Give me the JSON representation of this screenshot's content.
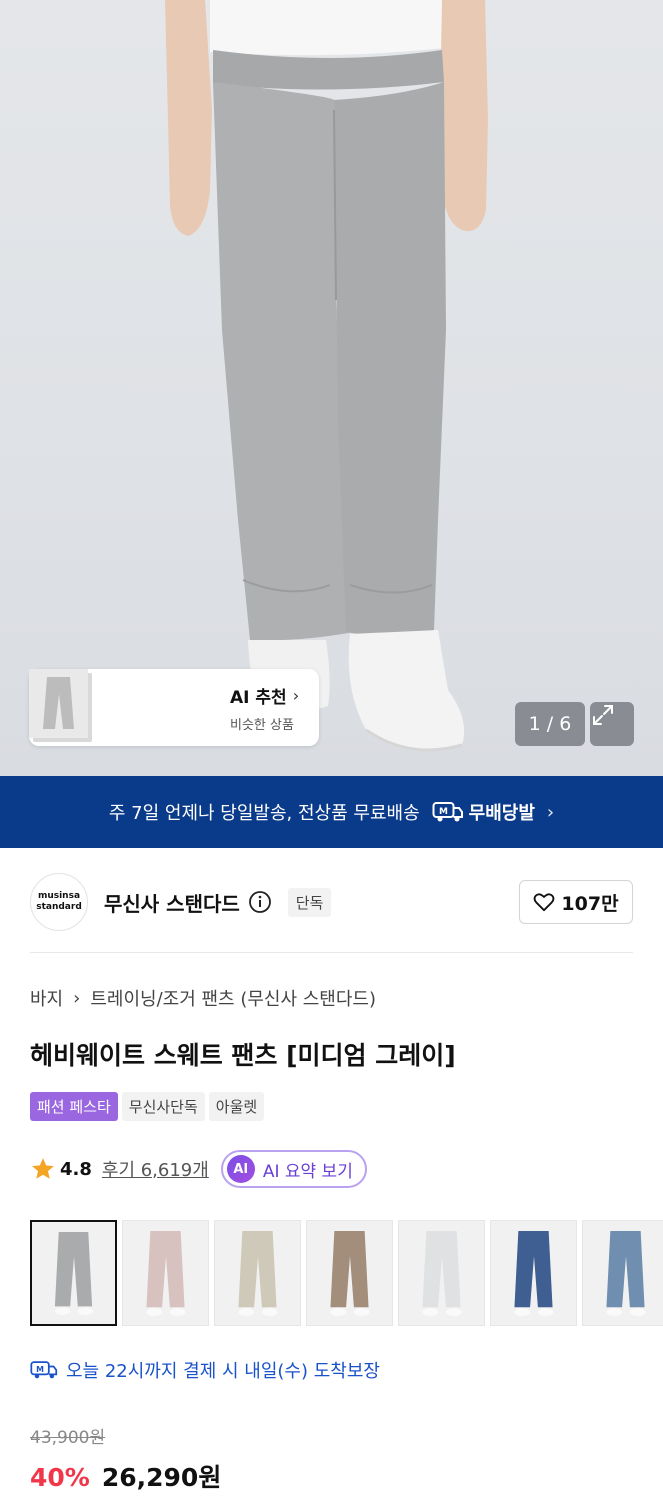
{
  "hero": {
    "ai_card": {
      "title": "AI 추천",
      "subtitle": "비슷한 상품"
    },
    "page_counter": "1 / 6"
  },
  "banner": {
    "text": "주 7일 언제나 당일발송, 전상품 무료배송",
    "brand": "무배당발"
  },
  "brand": {
    "logo_line1": "musinsa",
    "logo_line2": "standard",
    "name": "무신사 스탠다드",
    "badge": "단독",
    "likes": "107만"
  },
  "breadcrumb": {
    "level1": "바지",
    "level2": "트레이닝/조거 팬츠 (무신사 스탠다드)"
  },
  "product": {
    "title": "헤비웨이트 스웨트 팬츠 [미디엄 그레이]"
  },
  "tags": [
    "패션 페스타",
    "무신사단독",
    "아울렛"
  ],
  "rating": {
    "score": "4.8",
    "reviews": "후기 6,619개",
    "ai_summary": "AI 요약 보기",
    "ai_badge": "AI"
  },
  "colors": {
    "swatch_fills": [
      "#a9abad",
      "#d8c2c0",
      "#cfc9b9",
      "#a28e7a",
      "#dfe1e3",
      "#3f5e92",
      "#6f8eb0"
    ]
  },
  "delivery": {
    "text": "오늘 22시까지 결제 시 내일(수) 도착보장"
  },
  "price": {
    "original": "43,900원",
    "discount": "40%",
    "sale": "26,290원"
  },
  "theme": {
    "banner_bg": "#0a3a8a",
    "discount_color": "#f2364a",
    "fiesta_color": "#9a67e0",
    "delivery_color": "#1a52c9"
  }
}
